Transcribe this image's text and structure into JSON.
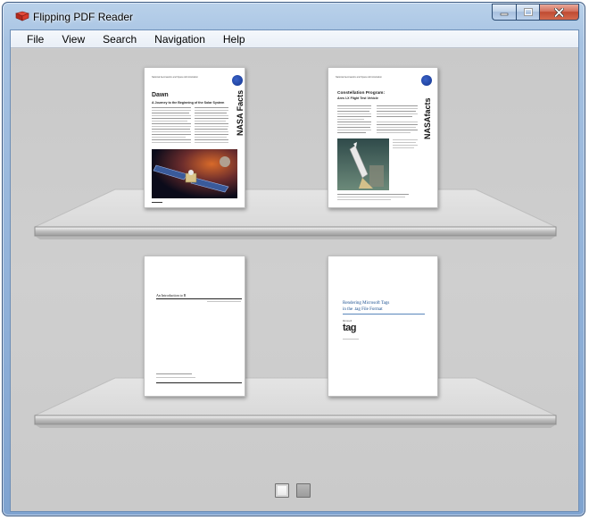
{
  "window": {
    "title": "Flipping PDF Reader"
  },
  "menu": {
    "items": [
      "File",
      "View",
      "Search",
      "Navigation",
      "Help"
    ]
  },
  "books": [
    {
      "header": "National Aeronautics and Space Administration",
      "title": "Dawn",
      "subtitle": "A Journey to the Beginning of the Solar System",
      "side_label": "NASA Facts"
    },
    {
      "header": "National Aeronautics and Space Administration",
      "title": "Constellation Program:",
      "subtitle": "Ares I-X Flight Test Vehicle",
      "side_label": "NASAfacts"
    },
    {
      "title": "An Introduction to R"
    },
    {
      "title_line1": "Rendering Microsoft Tags",
      "title_line2": "in the .tag File Format",
      "brand_small": "Microsoft",
      "brand": "tag"
    }
  ],
  "pager": {
    "current_page": 1,
    "total_pages": 2
  },
  "colors": {
    "window_frame": "#8fb0d8",
    "shelf_background": "#cfcfcf",
    "close_button": "#c04b32",
    "nasa_blue": "#15368f",
    "tag_title_blue": "#1a4f8f"
  }
}
